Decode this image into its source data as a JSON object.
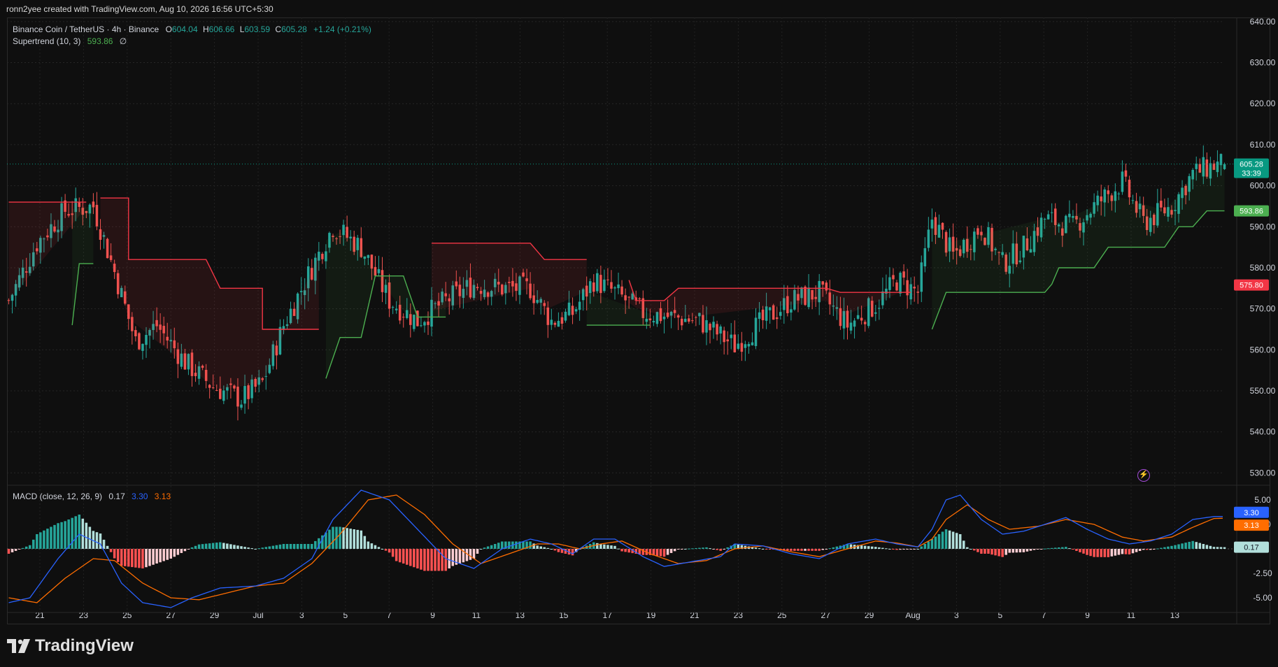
{
  "caption": "ronn2yee created with TradingView.com, Aug 10, 2026 16:56 UTC+5:30",
  "legend": {
    "symbol": "Binance Coin / TetherUS · 4h · Binance",
    "o_label": "O",
    "o_val": "604.04",
    "h_label": "H",
    "h_val": "606.66",
    "l_label": "L",
    "l_val": "603.59",
    "c_label": "C",
    "c_val": "605.28",
    "change": "+1.24 (+0.21%)",
    "supertrend_label": "Supertrend (10, 3)",
    "supertrend_val": "593.86",
    "supertrend_extra": "∅",
    "macd_label": "MACD (close, 12, 26, 9)",
    "macd_hist": "0.17",
    "macd_line": "3.30",
    "macd_signal": "3.13"
  },
  "price_tags": {
    "last": "605.28",
    "countdown": "33:39",
    "supertrend_up": "593.86",
    "supertrend_down": "575.80",
    "macd_line": "3.30",
    "macd_signal": "3.13",
    "macd_hist": "0.17"
  },
  "colors": {
    "up": "#26a69a",
    "down": "#ef5350",
    "supertrend_up": "#4caf50",
    "supertrend_down": "#f23645",
    "macd": "#2962ff",
    "signal": "#ff6d00",
    "hist_up_strong": "#26a69a",
    "hist_up_weak": "#b2dfdb",
    "hist_down_strong": "#ff5252",
    "hist_down_weak": "#ffcdd2"
  },
  "footer": {
    "brand": "TradingView"
  },
  "chart_data": [
    {
      "type": "candlestick",
      "title": "Binance Coin / TetherUS · 4h · Binance",
      "y_axis_labels": [
        "640.00",
        "630.00",
        "620.00",
        "610.00",
        "600.00",
        "590.00",
        "580.00",
        "570.00",
        "560.00",
        "550.00",
        "540.00",
        "530.00"
      ],
      "ylim": [
        527,
        641
      ],
      "x_tick_labels": [
        "21",
        "23",
        "25",
        "27",
        "29",
        "Jul",
        "3",
        "5",
        "7",
        "9",
        "11",
        "13",
        "15",
        "17",
        "19",
        "21",
        "23",
        "25",
        "27",
        "29",
        "Aug",
        "3",
        "5",
        "7",
        "9",
        "11",
        "13"
      ],
      "series_keypoints_close": [
        [
          0,
          572
        ],
        [
          8,
          586
        ],
        [
          16,
          594
        ],
        [
          24,
          595
        ],
        [
          30,
          579
        ],
        [
          36,
          562
        ],
        [
          42,
          566
        ],
        [
          50,
          557
        ],
        [
          58,
          551
        ],
        [
          66,
          548
        ],
        [
          72,
          552
        ],
        [
          78,
          566
        ],
        [
          86,
          580
        ],
        [
          92,
          590
        ],
        [
          100,
          585
        ],
        [
          108,
          572
        ],
        [
          116,
          567
        ],
        [
          124,
          572
        ],
        [
          132,
          576
        ],
        [
          140,
          575
        ],
        [
          148,
          575
        ],
        [
          154,
          567
        ],
        [
          160,
          569
        ],
        [
          166,
          577
        ],
        [
          172,
          574
        ],
        [
          180,
          569
        ],
        [
          188,
          568
        ],
        [
          196,
          567
        ],
        [
          206,
          561
        ],
        [
          214,
          567
        ],
        [
          222,
          572
        ],
        [
          230,
          574
        ],
        [
          238,
          566
        ],
        [
          246,
          571
        ],
        [
          252,
          577
        ],
        [
          258,
          574
        ],
        [
          262,
          592
        ],
        [
          268,
          583
        ],
        [
          276,
          590
        ],
        [
          282,
          581
        ],
        [
          288,
          585
        ],
        [
          294,
          592
        ],
        [
          302,
          590
        ],
        [
          308,
          595
        ],
        [
          316,
          601
        ],
        [
          322,
          591
        ],
        [
          330,
          595
        ],
        [
          336,
          603
        ],
        [
          342,
          605
        ],
        [
          345,
          605.28
        ]
      ],
      "supertrend": {
        "down_segments": [
          [
            [
              0,
              596
            ],
            [
              22,
              596
            ]
          ],
          [
            [
              26,
              597
            ],
            [
              34,
              597
            ],
            [
              34,
              582
            ],
            [
              56,
              582
            ],
            [
              60,
              575
            ],
            [
              72,
              575
            ],
            [
              72,
              565
            ],
            [
              88,
              565
            ]
          ],
          [
            [
              120,
              586
            ],
            [
              148,
              586
            ],
            [
              152,
              582
            ],
            [
              164,
              582
            ]
          ],
          [
            [
              176,
              577
            ],
            [
              178,
              572
            ],
            [
              186,
              572
            ],
            [
              190,
              575
            ],
            [
              232,
              575
            ],
            [
              236,
              574
            ],
            [
              256,
              574
            ]
          ]
        ],
        "up_segments": [
          [
            [
              18,
              566
            ],
            [
              20,
              581
            ],
            [
              24,
              581
            ]
          ],
          [
            [
              90,
              553
            ],
            [
              94,
              563
            ],
            [
              100,
              563
            ],
            [
              104,
              578
            ],
            [
              112,
              578
            ],
            [
              116,
              568
            ],
            [
              124,
              568
            ]
          ],
          [
            [
              164,
              566
            ],
            [
              182,
              566
            ]
          ],
          [
            [
              262,
              565
            ],
            [
              266,
              574
            ],
            [
              294,
              574
            ],
            [
              296,
              576
            ],
            [
              298,
              580
            ],
            [
              308,
              580
            ],
            [
              312,
              585
            ],
            [
              328,
              585
            ],
            [
              332,
              590
            ],
            [
              336,
              590
            ],
            [
              340,
              593.86
            ],
            [
              345,
              593.86
            ]
          ]
        ]
      }
    },
    {
      "type": "line",
      "title": "MACD (close, 12, 26, 9)",
      "y_axis_labels": [
        "5.00",
        "2.50",
        "-2.50",
        "-5.00"
      ],
      "ylim": [
        -6.5,
        6.5
      ],
      "series": [
        {
          "name": "MACD",
          "points": [
            [
              0,
              -5.5
            ],
            [
              6,
              -5.0
            ],
            [
              14,
              -1.0
            ],
            [
              20,
              1.5
            ],
            [
              26,
              0.5
            ],
            [
              32,
              -3.5
            ],
            [
              38,
              -5.5
            ],
            [
              46,
              -6.0
            ],
            [
              52,
              -5.0
            ],
            [
              60,
              -4.0
            ],
            [
              70,
              -3.8
            ],
            [
              78,
              -3.0
            ],
            [
              86,
              -1.0
            ],
            [
              92,
              3.0
            ],
            [
              100,
              6.0
            ],
            [
              108,
              5.0
            ],
            [
              116,
              2.0
            ],
            [
              124,
              -1.0
            ],
            [
              132,
              -2.0
            ],
            [
              140,
              0
            ],
            [
              148,
              1.0
            ],
            [
              154,
              0.5
            ],
            [
              160,
              -0.5
            ],
            [
              166,
              1.0
            ],
            [
              172,
              1.0
            ],
            [
              180,
              -0.8
            ],
            [
              186,
              -1.8
            ],
            [
              194,
              -1.3
            ],
            [
              202,
              -0.8
            ],
            [
              206,
              0.5
            ],
            [
              214,
              0.3
            ],
            [
              222,
              -0.5
            ],
            [
              230,
              -1.0
            ],
            [
              238,
              0.5
            ],
            [
              246,
              1.0
            ],
            [
              252,
              0.5
            ],
            [
              258,
              0.2
            ],
            [
              262,
              2.0
            ],
            [
              266,
              5.0
            ],
            [
              270,
              5.5
            ],
            [
              276,
              3.0
            ],
            [
              282,
              1.5
            ],
            [
              288,
              1.8
            ],
            [
              294,
              2.5
            ],
            [
              300,
              3.2
            ],
            [
              306,
              2.0
            ],
            [
              312,
              1.0
            ],
            [
              318,
              0.5
            ],
            [
              324,
              0.8
            ],
            [
              330,
              1.5
            ],
            [
              336,
              3.0
            ],
            [
              342,
              3.3
            ],
            [
              345,
              3.3
            ]
          ]
        },
        {
          "name": "Signal",
          "points": [
            [
              0,
              -5.0
            ],
            [
              8,
              -5.5
            ],
            [
              16,
              -3.0
            ],
            [
              24,
              -1.0
            ],
            [
              30,
              -1.2
            ],
            [
              38,
              -3.5
            ],
            [
              46,
              -5.0
            ],
            [
              54,
              -5.2
            ],
            [
              62,
              -4.5
            ],
            [
              70,
              -3.8
            ],
            [
              78,
              -3.5
            ],
            [
              86,
              -1.5
            ],
            [
              94,
              1.5
            ],
            [
              102,
              5.0
            ],
            [
              110,
              5.5
            ],
            [
              118,
              3.5
            ],
            [
              126,
              0.5
            ],
            [
              134,
              -1.5
            ],
            [
              142,
              -0.5
            ],
            [
              150,
              0.5
            ],
            [
              156,
              0.5
            ],
            [
              162,
              0
            ],
            [
              168,
              0.5
            ],
            [
              174,
              0.8
            ],
            [
              182,
              -0.5
            ],
            [
              190,
              -1.5
            ],
            [
              198,
              -1.2
            ],
            [
              206,
              0
            ],
            [
              214,
              0.3
            ],
            [
              222,
              -0.3
            ],
            [
              230,
              -0.8
            ],
            [
              238,
              0
            ],
            [
              246,
              0.8
            ],
            [
              252,
              0.6
            ],
            [
              258,
              0.2
            ],
            [
              262,
              1.0
            ],
            [
              266,
              3.0
            ],
            [
              272,
              4.5
            ],
            [
              278,
              3.0
            ],
            [
              284,
              2.0
            ],
            [
              292,
              2.3
            ],
            [
              300,
              3.0
            ],
            [
              308,
              2.5
            ],
            [
              316,
              1.2
            ],
            [
              322,
              0.8
            ],
            [
              330,
              1.2
            ],
            [
              336,
              2.2
            ],
            [
              342,
              3.1
            ],
            [
              345,
              3.13
            ]
          ]
        }
      ]
    }
  ]
}
